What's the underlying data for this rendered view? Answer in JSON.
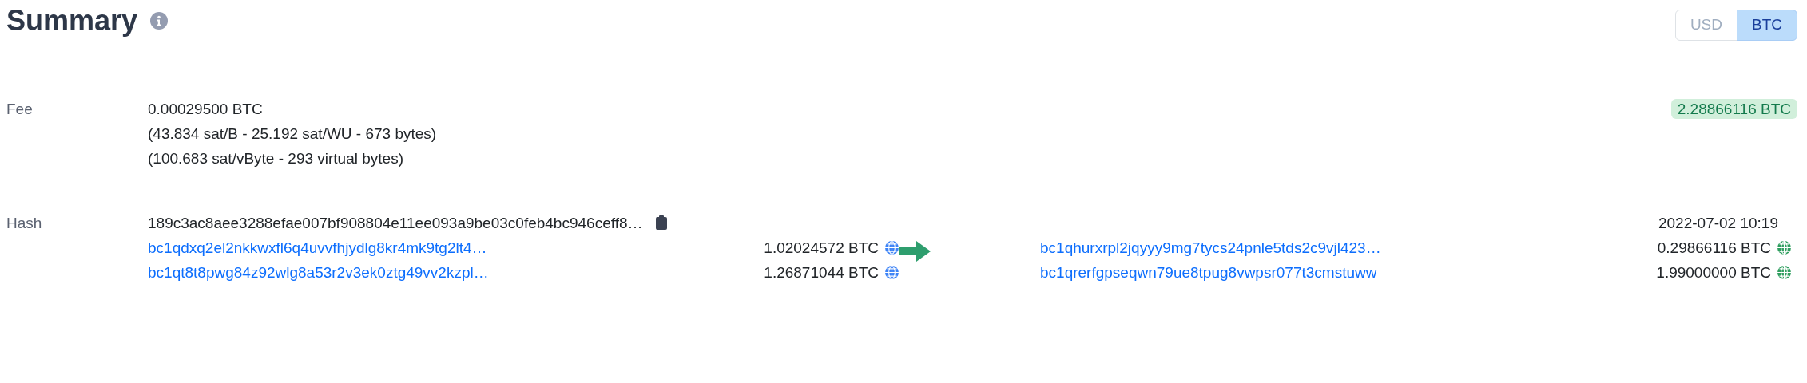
{
  "title": "Summary",
  "currency_toggle": [
    {
      "label": "USD",
      "selected": false
    },
    {
      "label": "BTC",
      "selected": true
    }
  ],
  "fee": {
    "label": "Fee",
    "lines": [
      "0.00029500 BTC",
      "(43.834 sat/B - 25.192 sat/WU - 673 bytes)",
      "(100.683 sat/vByte - 293 virtual bytes)"
    ],
    "total": "2.28866116 BTC"
  },
  "hash": {
    "label": "Hash",
    "value": "189c3ac8aee3288efae007bf908804e11ee093a9be03c0feb4bc946ceff8…",
    "time": "2022-07-02 10:19"
  },
  "inputs": [
    {
      "address": "bc1qdxq2el2nkkwxfl6q4uvvfhjydlg8kr4mk9tg2lt4…",
      "amount": "1.02024572 BTC"
    },
    {
      "address": "bc1qt8t8pwg84z92wlg8a53r2v3ek0ztg49vv2kzpl…",
      "amount": "1.26871044 BTC"
    }
  ],
  "outputs": [
    {
      "address": "bc1qhurxrpl2jqyyy9mg7tycs24pnle5tds2c9vjl423…",
      "amount": "0.29866116 BTC"
    },
    {
      "address": "bc1qrerfgpseqwn79ue8tpug8vwpsr077t3cmstuww",
      "amount": "1.99000000 BTC"
    }
  ]
}
